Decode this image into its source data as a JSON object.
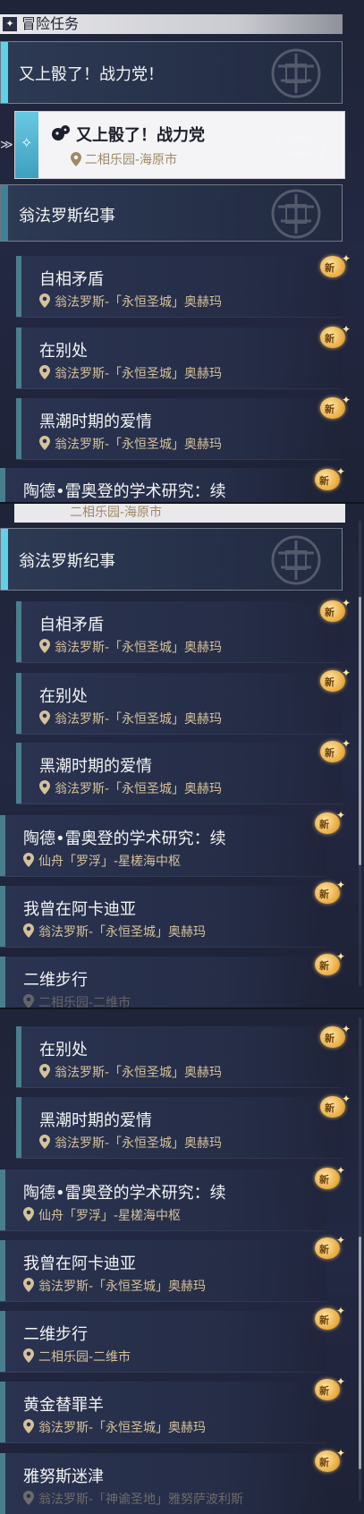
{
  "section": {
    "icon": "diamond-star-icon",
    "title": "冒险任务"
  },
  "group1": {
    "title": "又上骰了！战力党！"
  },
  "selected": {
    "icon": "dice-icon",
    "name": "又上骰了！战力党",
    "location": "二相乐园-海原市"
  },
  "group2": {
    "title": "翁法罗斯纪事"
  },
  "badge_text": "新",
  "quests": {
    "ziyang": {
      "name": "自相矛盾",
      "location": "翁法罗斯-「永恒圣城」奥赫玛"
    },
    "biechu": {
      "name": "在别处",
      "location": "翁法罗斯-「永恒圣城」奥赫玛"
    },
    "heichao": {
      "name": "黑潮时期的爱情",
      "location": "翁法罗斯-「永恒圣城」奥赫玛"
    },
    "taode": {
      "name": "陶德•雷奥登的学术研究：续",
      "location": "仙舟「罗浮」-星槎海中枢"
    },
    "akadiya": {
      "name": "我曾在阿卡迪亚",
      "location": "翁法罗斯-「永恒圣城」奥赫玛"
    },
    "erwei": {
      "name": "二维步行",
      "location": "二相乐园-二维市"
    },
    "huangjin": {
      "name": "黄金替罪羊",
      "location": "翁法罗斯-「永恒圣城」奥赫玛"
    },
    "yanusi": {
      "name": "雅努斯迷津",
      "location": "翁法罗斯-「神谕圣地」雅努萨波利斯"
    }
  },
  "partials": {
    "p1_cut": "陶德•雷奥登的学术研究：续",
    "p2_top_cut": "二相乐园-海原市",
    "p2_bottom_cut": "二相乐园-二维市"
  },
  "colors": {
    "accent_cyan": "#5fd3e6",
    "location_gold": "#d6c29a",
    "badge_gold": "#e7a83d"
  }
}
